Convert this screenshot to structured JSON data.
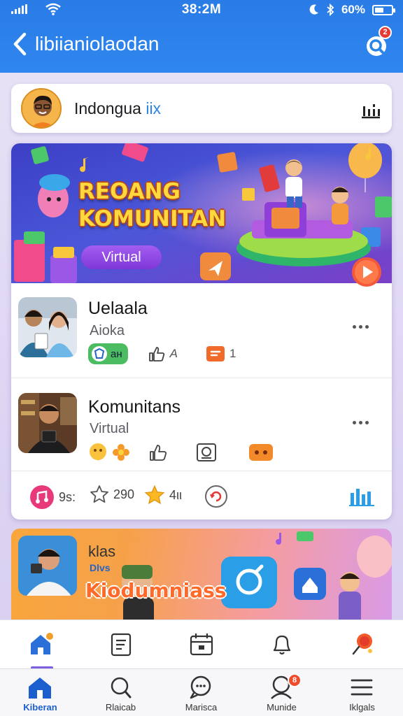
{
  "status_bar": {
    "time": "38:2M",
    "battery": "60%"
  },
  "header": {
    "title": "libiianiolaodan",
    "search_badge": "2"
  },
  "profile": {
    "name": "Indongua ",
    "name_suffix": "iix"
  },
  "banner": {
    "title_line1": "REOANG",
    "title_line2": "KOMUNITAN",
    "pill": "Virtual"
  },
  "posts": [
    {
      "title": "Uelaala",
      "subtitle": "Aioka",
      "chip_label": "aн",
      "like_label": "A",
      "comment_count": "1"
    },
    {
      "title": "Komunitans",
      "subtitle": "Virtual"
    }
  ],
  "stats": {
    "music_label": "9s:",
    "star_outline_count": "290",
    "star_count": "4ιι"
  },
  "preview": {
    "title": "klas",
    "subtitle": "Dlvs",
    "banner_text": "Kiodumniass"
  },
  "tabbar_badge": "",
  "bottom_nav": [
    {
      "label": "Kiberan",
      "icon": "home-icon",
      "active": true
    },
    {
      "label": "Rlaicab",
      "icon": "search-icon"
    },
    {
      "label": "Marisca",
      "icon": "chat-icon"
    },
    {
      "label": "Munide",
      "icon": "profile-icon",
      "badge": "8"
    },
    {
      "label": "Iklgals",
      "icon": "menu-icon"
    }
  ],
  "colors": {
    "primary": "#2b84e8",
    "accent": "#7d5fe0",
    "badge": "#e53935"
  }
}
